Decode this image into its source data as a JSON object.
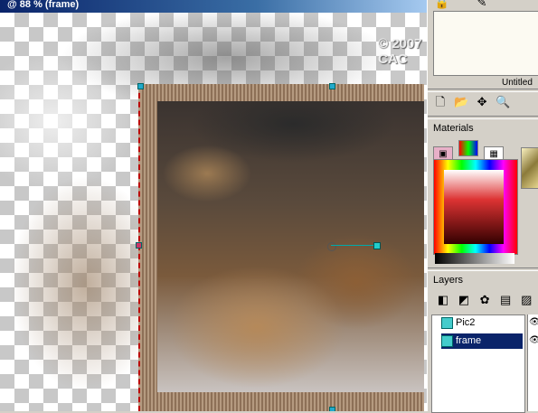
{
  "document": {
    "title": "@ 88 % (frame)",
    "watermark": "© 2007 CAC"
  },
  "overview": {
    "caption": "Untitled"
  },
  "top_tools": {
    "icons": [
      "lock-icon",
      "pen-icon"
    ]
  },
  "tool_row": {
    "icons": [
      "new-icon",
      "open-icon",
      "move-icon",
      "magnify-icon"
    ]
  },
  "materials": {
    "title": "Materials",
    "tabs": [
      "frame-tab",
      "rainbow-tab",
      "swatches-tab"
    ],
    "colors": {
      "foreground": "#d33333",
      "accent": "#0a246a"
    }
  },
  "layers": {
    "title": "Layers",
    "tool_icons": [
      "new-raster-icon",
      "new-vector-icon",
      "adjust-icon",
      "mask-icon",
      "group-icon"
    ],
    "items": [
      {
        "label": "Pic2",
        "visible": true,
        "selected": false
      },
      {
        "label": "frame",
        "visible": true,
        "selected": true
      }
    ]
  }
}
